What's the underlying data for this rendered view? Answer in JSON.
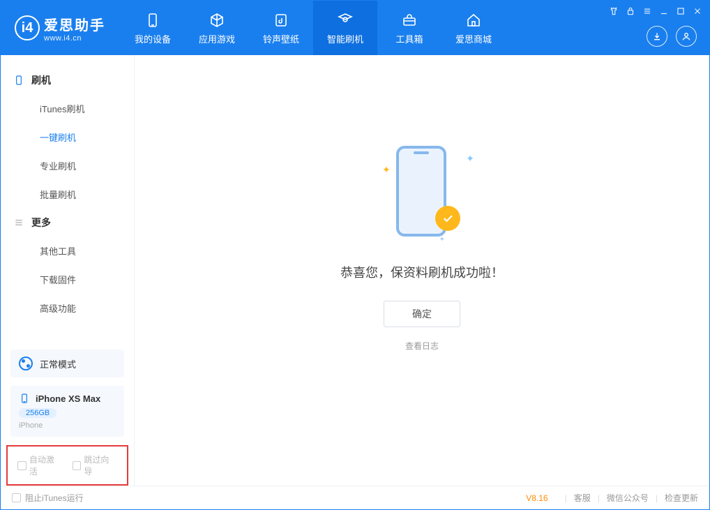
{
  "app": {
    "name": "爱思助手",
    "url": "www.i4.cn"
  },
  "tabs": [
    {
      "label": "我的设备",
      "icon": "device"
    },
    {
      "label": "应用游戏",
      "icon": "cube"
    },
    {
      "label": "铃声壁纸",
      "icon": "music"
    },
    {
      "label": "智能刷机",
      "icon": "refresh",
      "active": true
    },
    {
      "label": "工具箱",
      "icon": "toolbox"
    },
    {
      "label": "爱思商城",
      "icon": "home"
    }
  ],
  "sidebar": {
    "section1": {
      "title": "刷机",
      "items": [
        "iTunes刷机",
        "一键刷机",
        "专业刷机",
        "批量刷机"
      ],
      "activeIndex": 1
    },
    "section2": {
      "title": "更多",
      "items": [
        "其他工具",
        "下载固件",
        "高级功能"
      ]
    }
  },
  "mode": {
    "label": "正常模式"
  },
  "device": {
    "name": "iPhone XS Max",
    "storage": "256GB",
    "type": "iPhone"
  },
  "bottomChecks": {
    "auto_activate": "自动激活",
    "skip_guide": "跳过向导"
  },
  "main": {
    "success_text": "恭喜您，保资料刷机成功啦！",
    "ok_btn": "确定",
    "view_log": "查看日志"
  },
  "footer": {
    "block_itunes": "阻止iTunes运行",
    "version": "V8.16",
    "links": [
      "客服",
      "微信公众号",
      "检查更新"
    ]
  }
}
